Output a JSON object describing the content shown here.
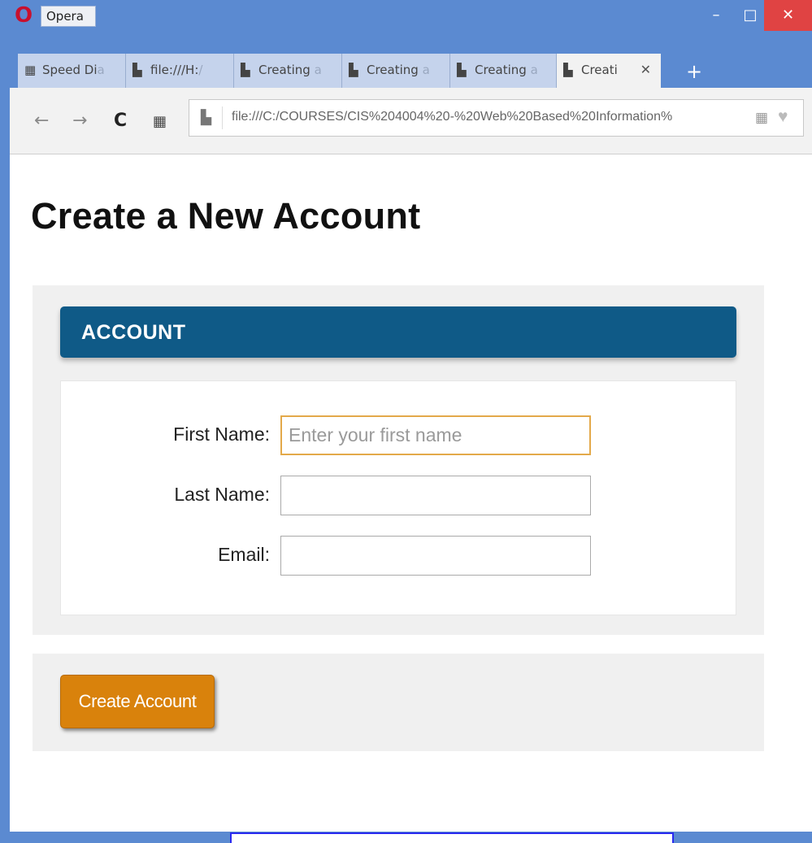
{
  "window": {
    "app_name": "Opera",
    "minimize_glyph": "–",
    "maximize_glyph": "□",
    "close_glyph": "✕"
  },
  "tabs": [
    {
      "label": "Speed Di",
      "fade": "a",
      "icon": "speed-dial-icon",
      "glyph": "▦"
    },
    {
      "label": "file:///H:",
      "fade": "/",
      "icon": "page-icon",
      "glyph": "▙"
    },
    {
      "label": "Creating",
      "fade": " a",
      "icon": "page-icon",
      "glyph": "▙"
    },
    {
      "label": "Creating",
      "fade": " a",
      "icon": "page-icon",
      "glyph": "▙"
    },
    {
      "label": "Creating",
      "fade": " a",
      "icon": "page-icon",
      "glyph": "▙"
    },
    {
      "label": "Creati",
      "fade": "",
      "icon": "page-icon",
      "glyph": "▙",
      "active": true,
      "close_glyph": "✕"
    }
  ],
  "new_tab_glyph": "+",
  "toolbar": {
    "back_glyph": "←",
    "forward_glyph": "→",
    "reload_glyph": "C",
    "speed_dial_glyph": "▦",
    "url": "file:///C:/COURSES/CIS%204004%20-%20Web%20Based%20Information%",
    "page_icon_glyph": "▙",
    "url_grid_glyph": "▦",
    "heart_glyph": "♥"
  },
  "page": {
    "title": "Create a New Account",
    "section_header": "ACCOUNT",
    "fields": {
      "first_name": {
        "label": "First Name:",
        "placeholder": "Enter your first name",
        "value": ""
      },
      "last_name": {
        "label": "Last Name:",
        "placeholder": "",
        "value": ""
      },
      "email": {
        "label": "Email:",
        "placeholder": "",
        "value": ""
      }
    },
    "submit_label": "Create Account"
  },
  "colors": {
    "window_frame": "#5b8ad1",
    "close_button": "#e04343",
    "section_header_bg": "#0f5a87",
    "submit_button_bg": "#d9820c",
    "focus_border": "#e3a94a"
  }
}
